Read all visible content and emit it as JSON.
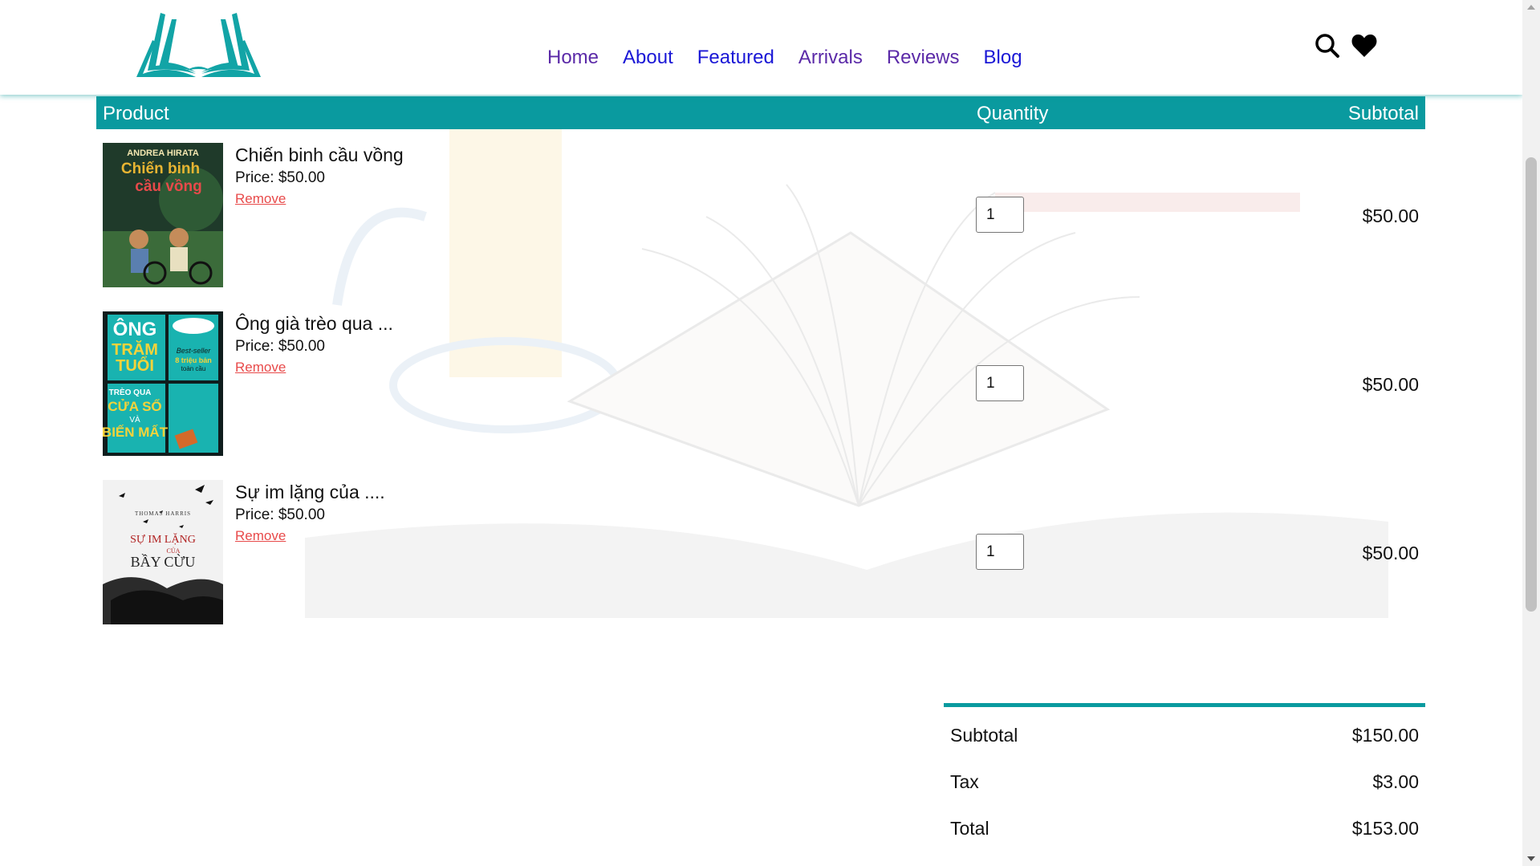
{
  "brand": {
    "logo_icon": "open-book-logo",
    "accent": "#0a9a9f"
  },
  "nav": {
    "items": [
      {
        "label": "Home",
        "state": "visited"
      },
      {
        "label": "About",
        "state": "unvisited"
      },
      {
        "label": "Featured",
        "state": "unvisited"
      },
      {
        "label": "Arrivals",
        "state": "visited"
      },
      {
        "label": "Reviews",
        "state": "visited"
      },
      {
        "label": "Blog",
        "state": "unvisited"
      }
    ],
    "visited_color": "#5b2aa8",
    "link_color": "#1a17d6"
  },
  "header_icons": [
    "search-icon",
    "heart-icon"
  ],
  "cart": {
    "columns": {
      "product": "Product",
      "quantity": "Quantity",
      "subtotal": "Subtotal"
    },
    "items": [
      {
        "title": "Chiến binh cầu vồng",
        "price": "Price: $50.00",
        "remove": "Remove",
        "quantity": "1",
        "subtotal": "$50.00",
        "cover": {
          "author": "ANDREA HIRATA",
          "lines": [
            "Chiến binh",
            "cầu vồng"
          ]
        }
      },
      {
        "title": "Ông già trèo qua ...",
        "price": "Price: $50.00",
        "remove": "Remove",
        "quantity": "1",
        "subtotal": "$50.00",
        "cover": {
          "lines": [
            "ÔNG",
            "TRĂM",
            "TUỔI",
            "TRÈO QUA",
            "CỬA SỔ",
            "VÀ",
            "BIẾN MẤT"
          ],
          "badge": [
            "Best-seller",
            "8 triệu bản",
            "toàn cầu"
          ]
        }
      },
      {
        "title": "Sự im lặng của ....",
        "price": "Price: $50.00",
        "remove": "Remove",
        "quantity": "1",
        "subtotal": "$50.00",
        "cover": {
          "author": "THOMAS HARRIS",
          "lines": [
            "SỰ IM LẶNG",
            "CỦA",
            "BẦY CỪU"
          ]
        }
      }
    ],
    "remove_color": "#e84a4a"
  },
  "totals": [
    {
      "label": "Subtotal",
      "value": "$150.00"
    },
    {
      "label": "Tax",
      "value": "$3.00"
    },
    {
      "label": "Total",
      "value": "$153.00"
    }
  ]
}
